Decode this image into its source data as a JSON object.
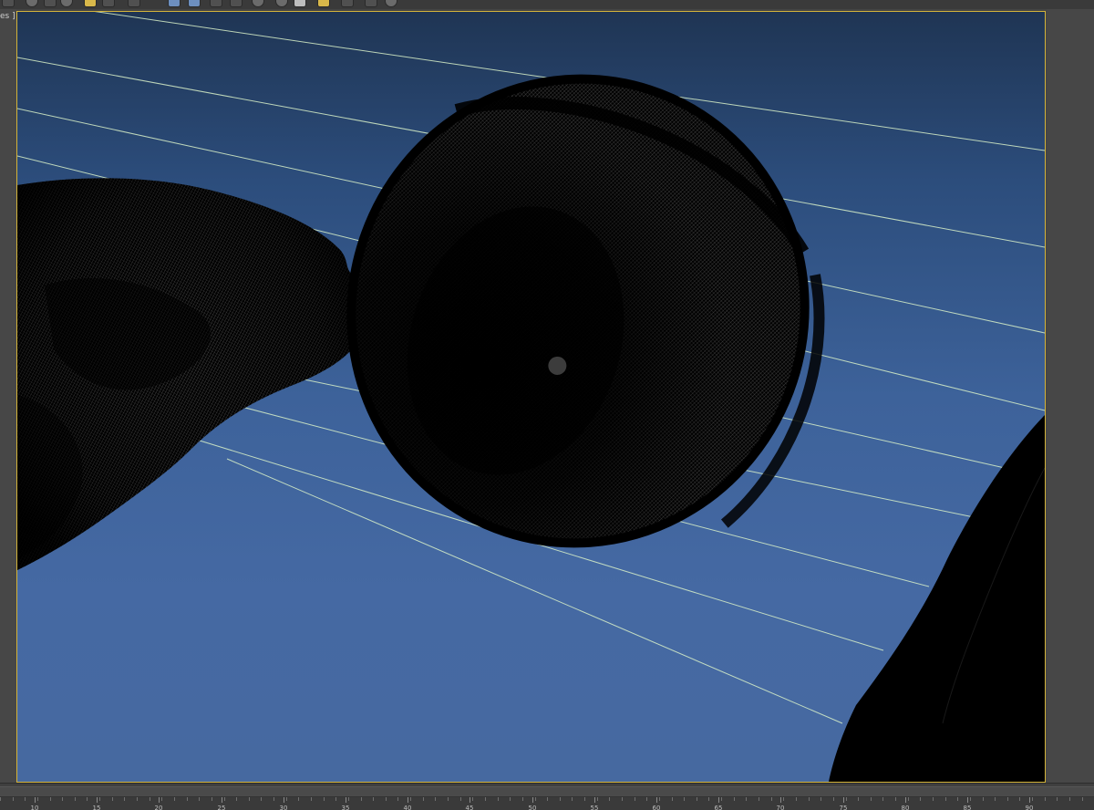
{
  "viewport": {
    "label": "es ]"
  },
  "toolbar": {
    "buttons": [
      {
        "name": "select-tool-icon",
        "style": "dark"
      },
      {
        "name": "link-tool-icon",
        "style": "round"
      },
      {
        "name": "unlink-tool-icon",
        "style": "dark"
      },
      {
        "name": "bind-tool-icon",
        "style": "round"
      },
      {
        "name": "sun-light-icon",
        "style": "yellow"
      },
      {
        "name": "camera-icon",
        "style": "dark"
      },
      {
        "name": "move-tool-icon",
        "style": "dark"
      },
      {
        "name": "render-frame-icon",
        "style": "blue"
      },
      {
        "name": "render-setup-icon",
        "style": "blue"
      },
      {
        "name": "material-editor-icon",
        "style": "dark"
      },
      {
        "name": "render-icon",
        "style": "dark"
      },
      {
        "name": "teapot-icon",
        "style": "round"
      },
      {
        "name": "sphere-icon",
        "style": "round"
      },
      {
        "name": "scene-explorer-icon",
        "style": "white"
      },
      {
        "name": "layer-manager-icon",
        "style": "yellow"
      },
      {
        "name": "graph-editor-icon",
        "style": "dark"
      },
      {
        "name": "schematic-view-icon",
        "style": "dark"
      },
      {
        "name": "help-icon",
        "style": "round"
      }
    ]
  },
  "timeline": {
    "ticks": [
      "10",
      "15",
      "20",
      "25",
      "30",
      "35",
      "40",
      "45",
      "50",
      "55",
      "60",
      "65",
      "70",
      "75",
      "80",
      "85",
      "90"
    ]
  },
  "colors": {
    "viewport_border": "#d4b43a",
    "grid_line": "#d8f0c8",
    "mesh": "#000000",
    "background_top": "#1f3554",
    "background_bottom": "#4669a0"
  }
}
